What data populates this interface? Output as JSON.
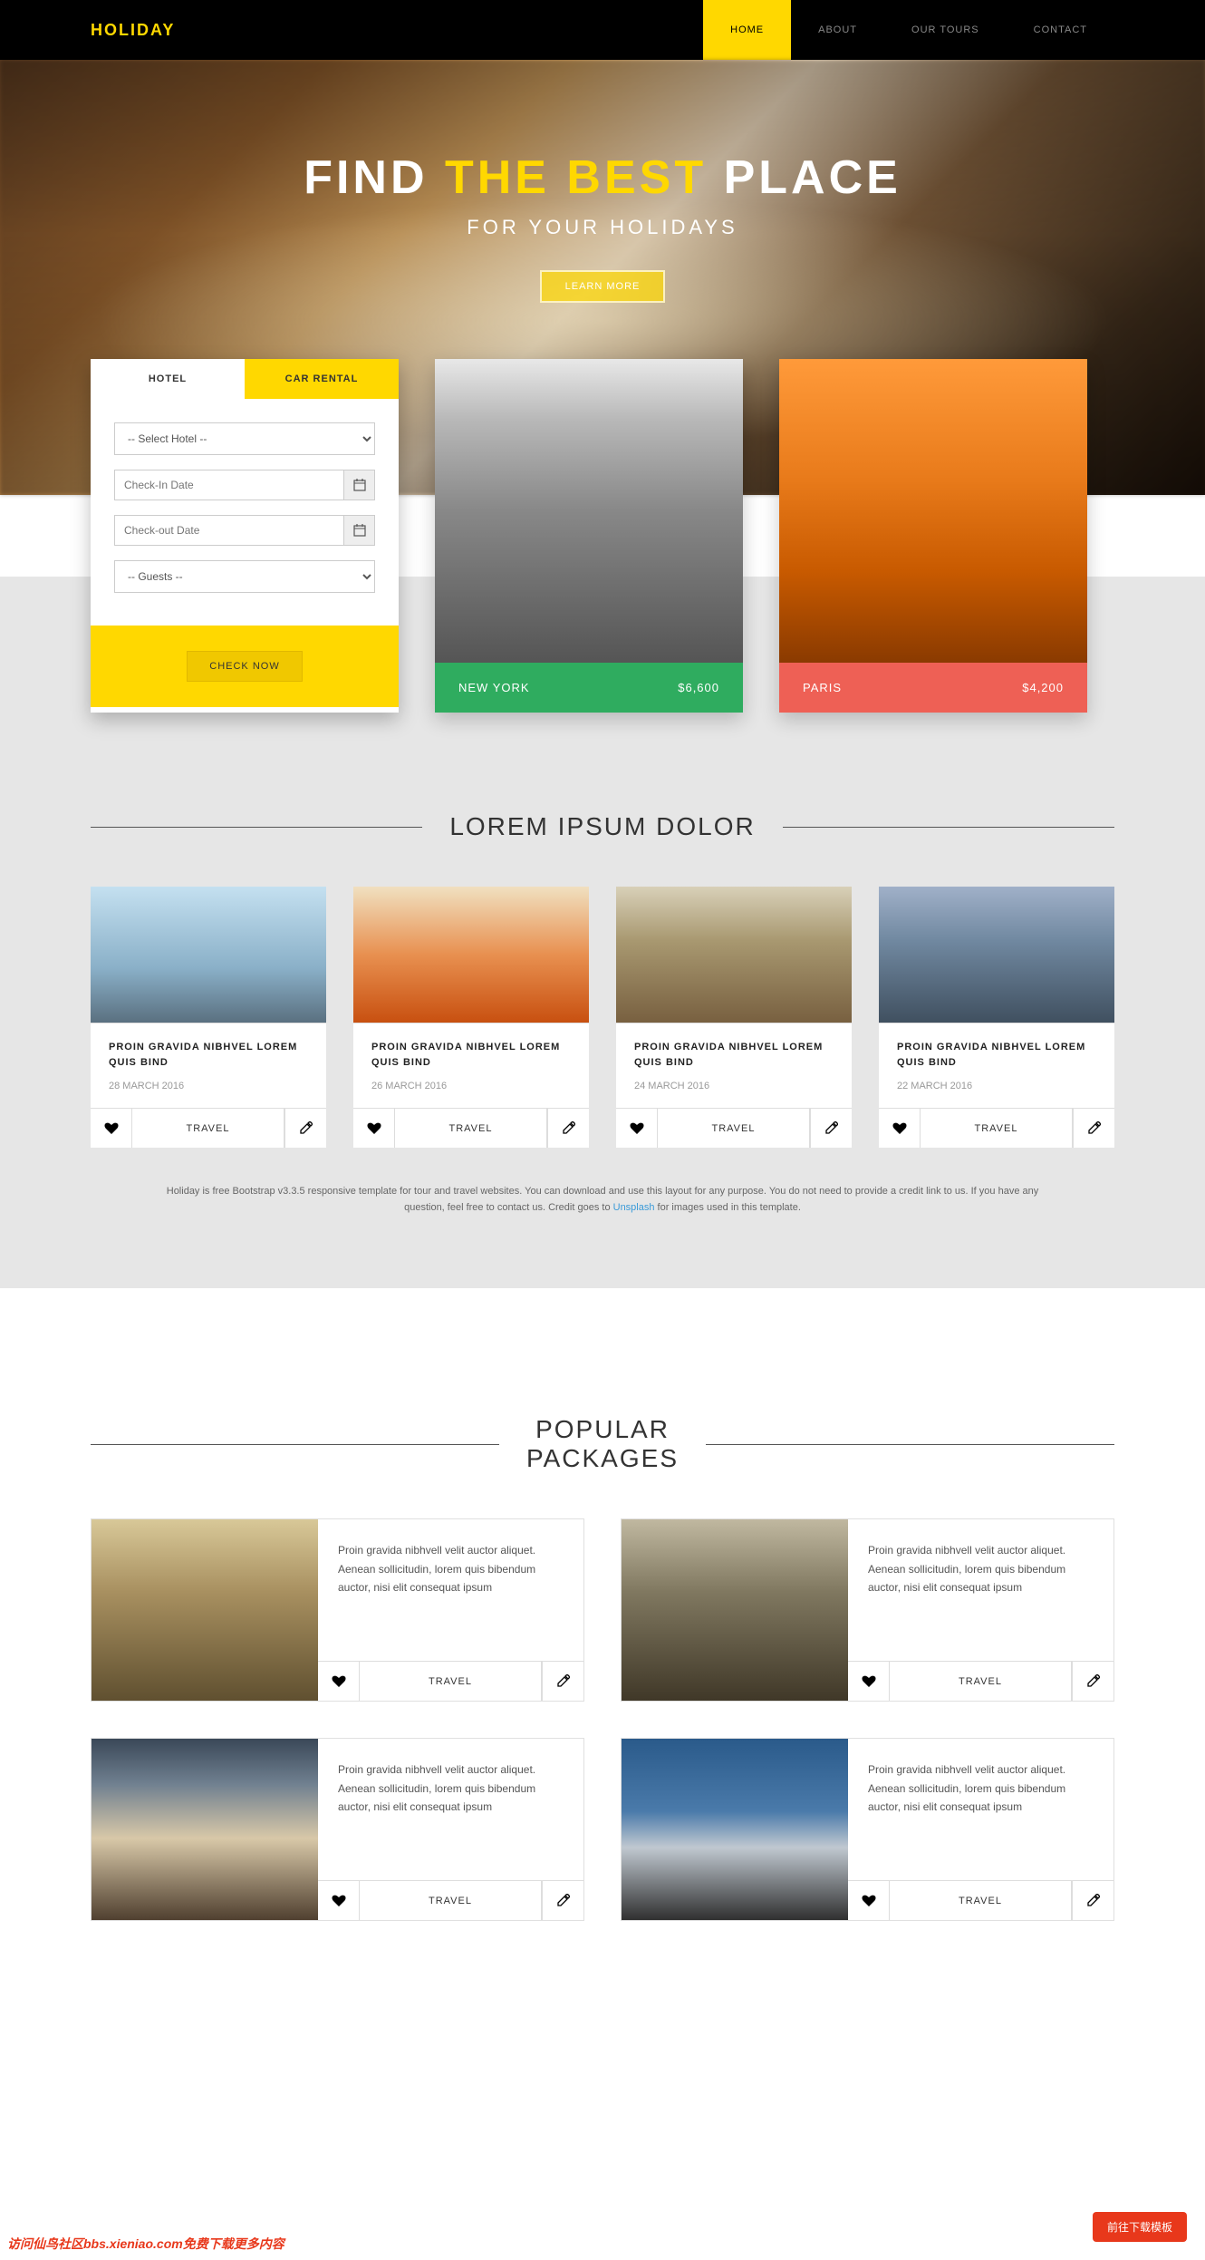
{
  "brand": "HOLIDAY",
  "nav": [
    "HOME",
    "ABOUT",
    "OUR TOURS",
    "CONTACT"
  ],
  "hero": {
    "t1": "FIND",
    "t2": "THE",
    "t3": "BEST",
    "t4": "PLACE",
    "sub": "FOR YOUR HOLIDAYS",
    "cta": "LEARN MORE"
  },
  "booking": {
    "tab_hotel": "HOTEL",
    "tab_car": "CAR RENTAL",
    "select_hotel": "-- Select Hotel --",
    "checkin": "Check-In Date",
    "checkout": "Check-out Date",
    "guests": "-- Guests --",
    "submit": "CHECK NOW"
  },
  "destinations": [
    {
      "name": "NEW YORK",
      "price": "$6,600",
      "bar": "#2fac5f"
    },
    {
      "name": "PARIS",
      "price": "$4,200",
      "bar": "#ee6055"
    }
  ],
  "section1_title": "LOREM IPSUM DOLOR",
  "articles": [
    {
      "title": "PROIN GRAVIDA NIBHVEL LOREM QUIS BIND",
      "date": "28 MARCH 2016",
      "tag": "TRAVEL"
    },
    {
      "title": "PROIN GRAVIDA NIBHVEL LOREM QUIS BIND",
      "date": "26 MARCH 2016",
      "tag": "TRAVEL"
    },
    {
      "title": "PROIN GRAVIDA NIBHVEL LOREM QUIS BIND",
      "date": "24 MARCH 2016",
      "tag": "TRAVEL"
    },
    {
      "title": "PROIN GRAVIDA NIBHVEL LOREM QUIS BIND",
      "date": "22 MARCH 2016",
      "tag": "TRAVEL"
    }
  ],
  "credits_pre": "Holiday is free Bootstrap v3.3.5 responsive template for tour and travel websites. You can download and use this layout for any purpose. You do not need to provide a credit link to us. If you have any question, feel free to contact us. Credit goes to ",
  "credits_link": "Unsplash",
  "credits_post": " for images used in this template.",
  "section2_title": "POPULAR PACKAGES",
  "pkg_text": "Proin gravida nibhvell velit auctor aliquet. Aenean sollicitudin, lorem quis bibendum auctor, nisi elit consequat ipsum",
  "pkg_tag": "TRAVEL",
  "float_btn": "前往下载模板",
  "watermark": "访问仙鸟社区bbs.xieniao.com免费下载更多内容"
}
